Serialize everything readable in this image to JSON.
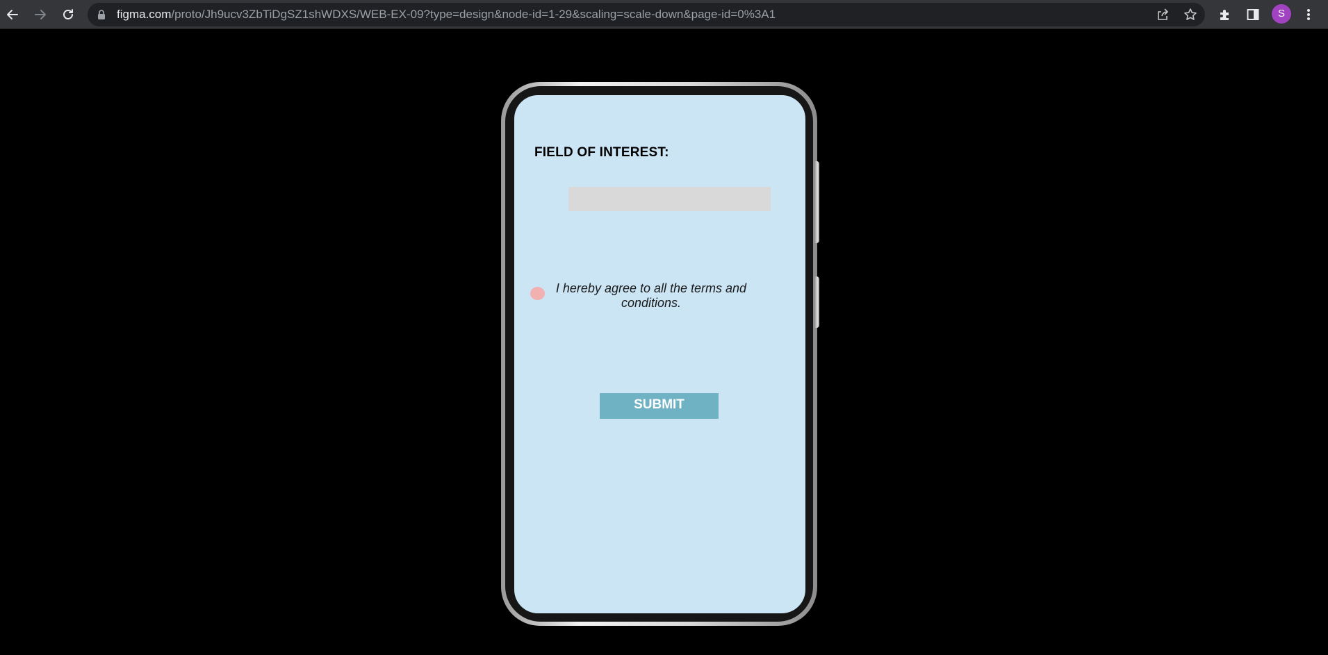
{
  "browser": {
    "url_host": "figma.com",
    "url_path": "/proto/Jh9ucv3ZbTiDgSZ1shWDXS/WEB-EX-09?type=design&node-id=1-29&scaling=scale-down&page-id=0%3A1",
    "profile_initial": "S",
    "icons": {
      "back": "arrow-left-icon",
      "forward": "arrow-right-icon",
      "reload": "reload-icon",
      "lock": "lock-icon",
      "share": "share-icon",
      "bookmark": "star-icon",
      "extensions": "puzzle-icon",
      "side_panel": "side-panel-icon",
      "menu": "kebab-menu-icon"
    }
  },
  "form": {
    "field_label": "FIELD OF INTEREST:",
    "field_value": "",
    "agree_text": "I hereby agree to all the terms and conditions.",
    "submit_label": "SUBMIT"
  },
  "colors": {
    "screen_bg": "#cbe5f5",
    "input_bg": "#d9d9d9",
    "radio": "#f2b1b1",
    "submit_bg": "#6fb2c4",
    "avatar": "#a142c0"
  }
}
